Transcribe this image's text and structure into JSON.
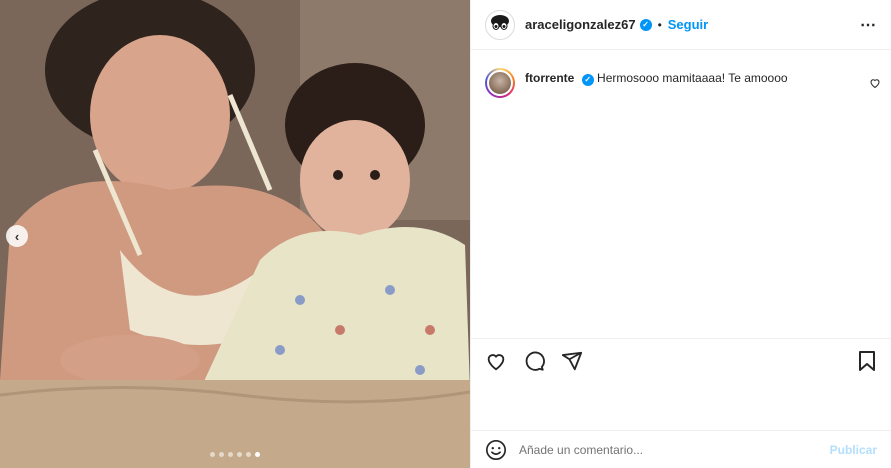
{
  "post": {
    "author": "araceligonzalez67",
    "separator": "•",
    "follow_label": "Seguir",
    "more_label": "⋯",
    "carousel": {
      "total_images": 6,
      "active_index": 5
    }
  },
  "comments": [
    {
      "user": "ftorrente",
      "verified": true,
      "text": "Hermosooo mamitaaaa! Te amoooo"
    }
  ],
  "composer": {
    "placeholder": "Añade un comentario...",
    "publish_label": "Publicar"
  },
  "colors": {
    "accent": "#0095f6",
    "publish_disabled": "#b2dffc",
    "text": "#262626"
  }
}
